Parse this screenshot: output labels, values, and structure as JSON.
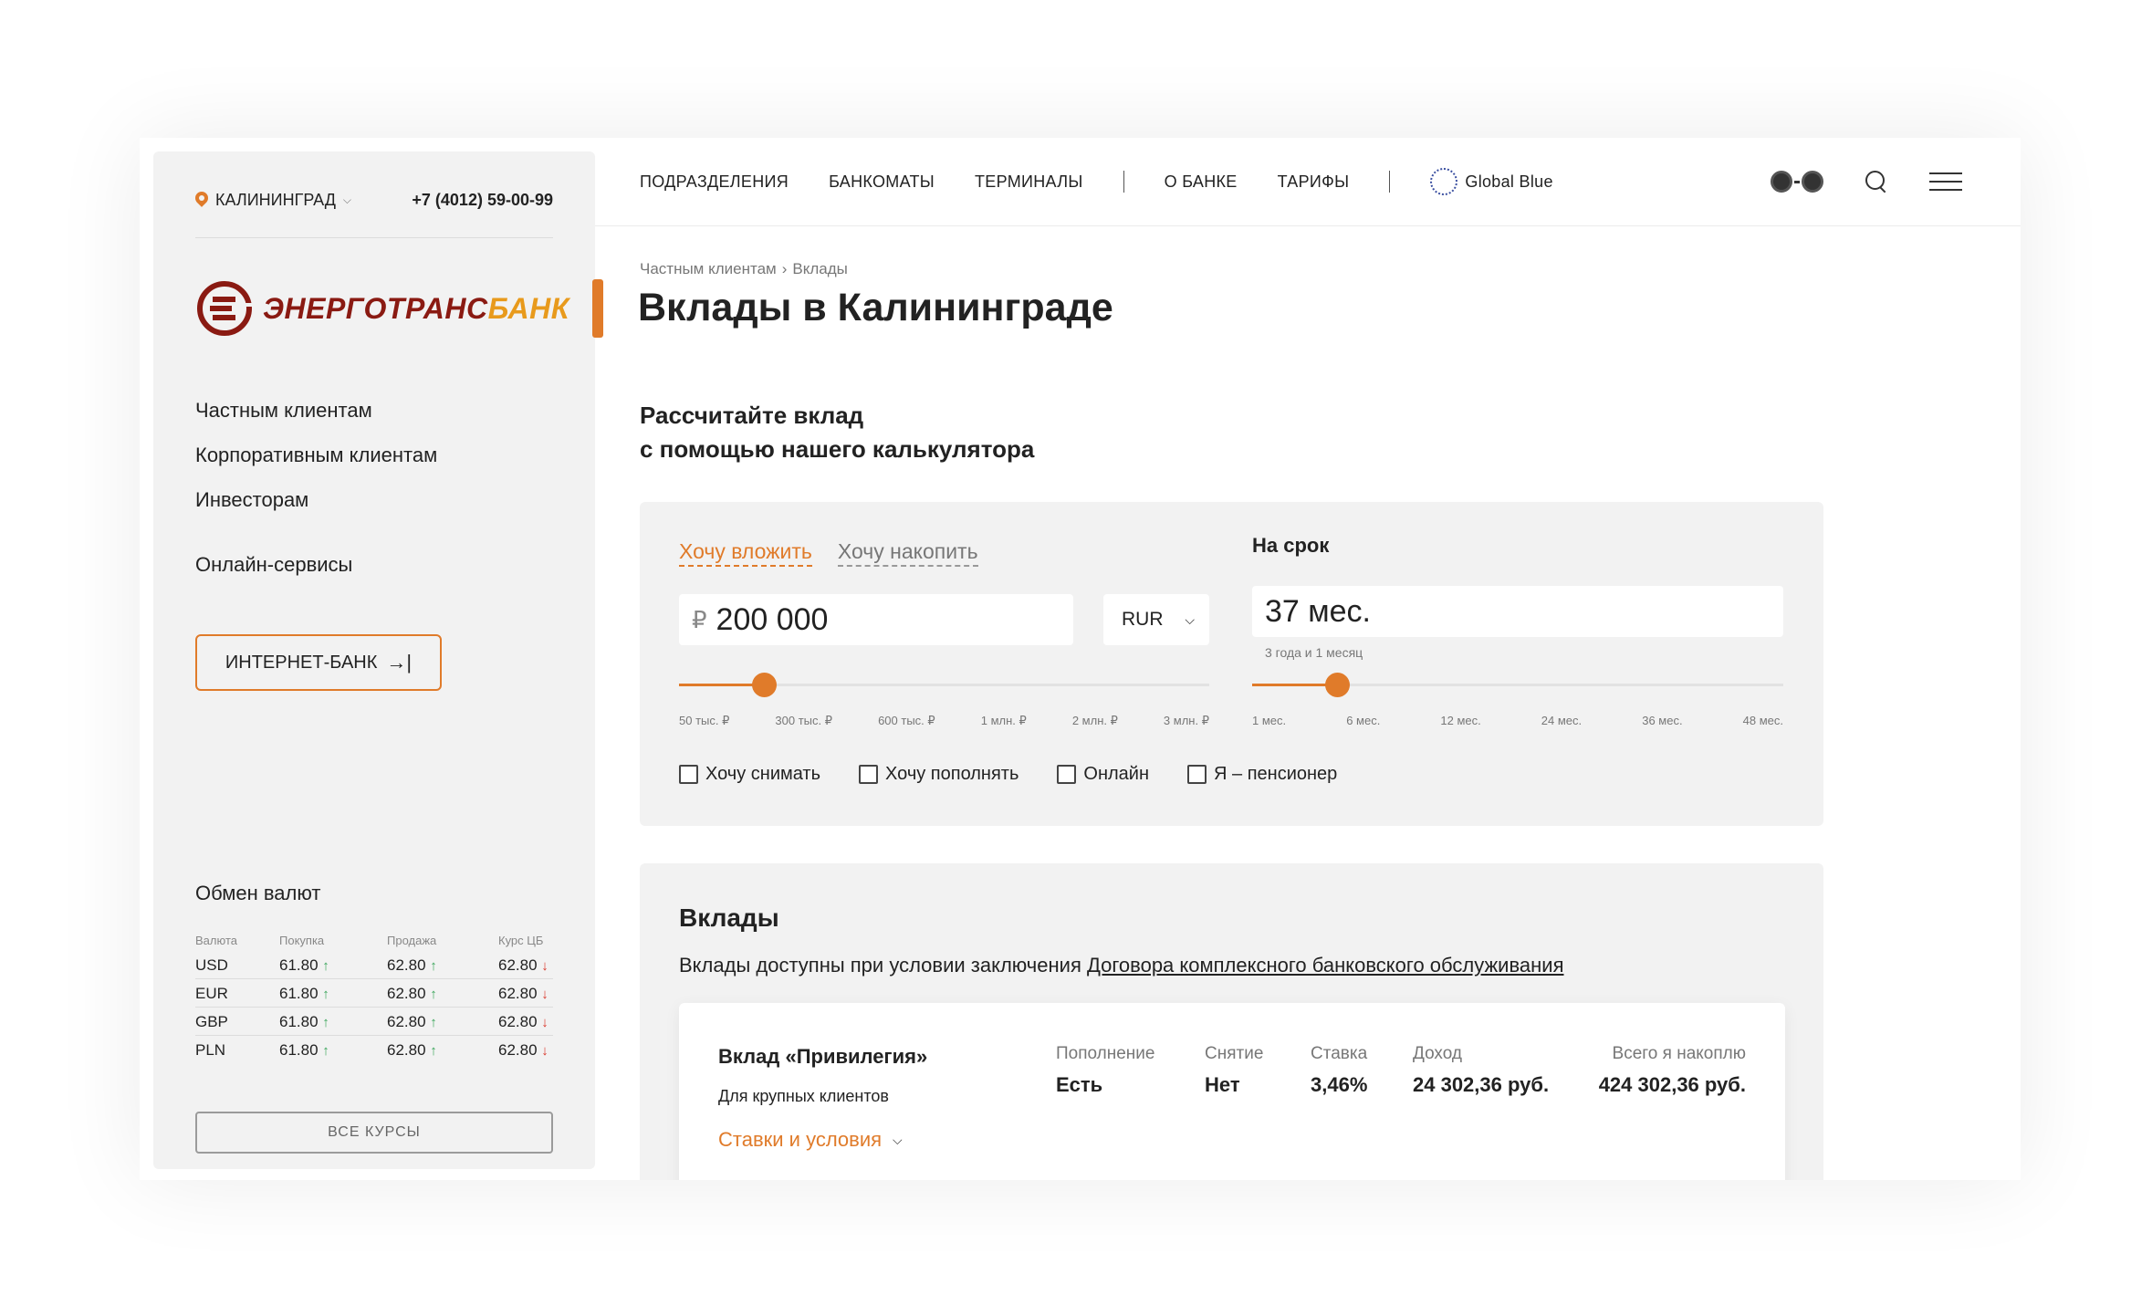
{
  "header_left": {
    "city": "КАЛИНИНГРАД",
    "phone": "+7 (4012) 59-00-99"
  },
  "logo": {
    "part1": "ЭНЕРГОТРАНС",
    "part2": "БАНК",
    "colors": {
      "primary": "#8a1a12",
      "accent": "#e89a1c"
    }
  },
  "sidebar": {
    "nav": [
      "Частным клиентам",
      "Корпоративным клиентам",
      "Инвесторам"
    ],
    "online": "Онлайн-сервисы",
    "internet_bank": "ИНТЕРНЕТ-БАНК",
    "internet_bank_icon": "login-arrow-icon"
  },
  "fx": {
    "title": "Обмен валют",
    "headers": [
      "Валюта",
      "Покупка",
      "Продажа",
      "Курс ЦБ"
    ],
    "rows": [
      {
        "cur": "USD",
        "buy": "61.80",
        "sell": "62.80",
        "cb": "62.80"
      },
      {
        "cur": "EUR",
        "buy": "61.80",
        "sell": "62.80",
        "cb": "62.80"
      },
      {
        "cur": "GBP",
        "buy": "61.80",
        "sell": "62.80",
        "cb": "62.80"
      },
      {
        "cur": "PLN",
        "buy": "61.80",
        "sell": "62.80",
        "cb": "62.80"
      }
    ],
    "up_glyph": "↑",
    "down_glyph": "↓",
    "all_button": "ВСЕ КУРСЫ"
  },
  "topnav": {
    "items": [
      "ПОДРАЗДЕЛЕНИЯ",
      "БАНКОМАТЫ",
      "ТЕРМИНАЛЫ",
      "О БАНКЕ",
      "ТАРИФЫ"
    ],
    "global_blue": "Global Blue",
    "icons": [
      "accessibility-glasses-icon",
      "search-icon",
      "menu-icon"
    ]
  },
  "breadcrumb": {
    "parent": "Частным клиентам",
    "separator": "›",
    "current": "Вклады"
  },
  "page_title": "Вклады в Калининграде",
  "calculator": {
    "heading_line1": "Рассчитайте вклад",
    "heading_line2": "с помощью нашего калькулятора",
    "tabs": [
      {
        "label": "Хочу вложить",
        "active": true
      },
      {
        "label": "Хочу накопить",
        "active": false
      }
    ],
    "amount_symbol": "₽",
    "amount_value": "200 000",
    "currency": "RUR",
    "amount_slider": {
      "ticks": [
        "50 тыс. ₽",
        "300 тыс. ₽",
        "600 тыс. ₽",
        "1 млн. ₽",
        "2 млн. ₽",
        "3 млн. ₽"
      ],
      "fraction": 0.16
    },
    "term_label": "На срок",
    "term_value": "37 мес.",
    "term_sub": "3 года и 1 месяц",
    "term_slider": {
      "ticks": [
        "1 мес.",
        "6 мес.",
        "12 мес.",
        "24 мес.",
        "36 мес.",
        "48 мес."
      ],
      "fraction": 0.16
    },
    "checkboxes": [
      "Хочу снимать",
      "Хочу пополнять",
      "Онлайн",
      "Я – пенсионер"
    ]
  },
  "deposits": {
    "title": "Вклады",
    "note": "Вклады доступны при условии заключения ",
    "note_link": "Договора комплексного банковского обслуживания",
    "card": {
      "name": "Вклад «Привилегия»",
      "subtitle": "Для крупных клиентов",
      "link": "Ставки и условия",
      "columns": [
        {
          "label": "Пополнение",
          "value": "Есть"
        },
        {
          "label": "Снятие",
          "value": "Нет"
        },
        {
          "label": "Ставка",
          "value": "3,46%"
        },
        {
          "label": "Доход",
          "value": "24 302,36 руб."
        },
        {
          "label": "Всего я накоплю",
          "value": "424 302,36 руб."
        }
      ]
    }
  },
  "colors": {
    "accent": "#e07b2a",
    "panel": "#f2f2f2",
    "up": "#3aa55a",
    "down": "#d9362b"
  }
}
